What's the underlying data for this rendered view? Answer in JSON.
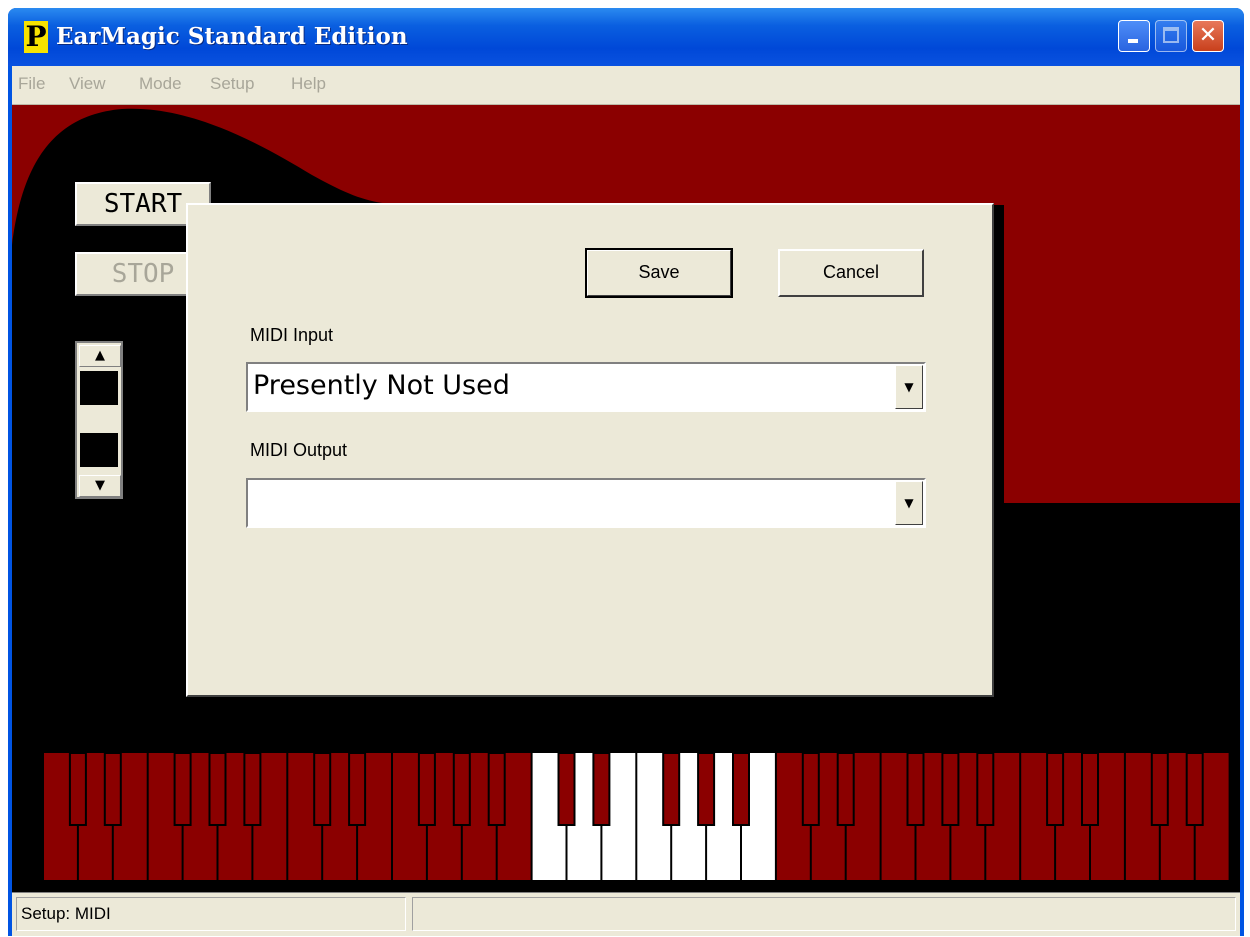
{
  "window": {
    "title": "EarMagic Standard Edition",
    "icon_letter": "P"
  },
  "titlebar_buttons": {
    "minimize": "minimize-icon",
    "maximize": "maximize-icon",
    "close": "close-icon"
  },
  "menu": {
    "items": [
      "File",
      "View",
      "Mode",
      "Setup",
      "Help"
    ]
  },
  "controls": {
    "start_label": "START",
    "stop_label": "STOP"
  },
  "spinner": {
    "up_icon": "triangle-up-icon",
    "down_icon": "triangle-down-icon"
  },
  "dialog": {
    "save_label": "Save",
    "cancel_label": "Cancel",
    "midi_input_label": "MIDI Input",
    "midi_input_value": "Presently Not Used",
    "midi_output_label": "MIDI Output",
    "midi_output_value": ""
  },
  "status": {
    "left": "Setup: MIDI",
    "right": ""
  },
  "colors": {
    "theme_red": "#8b0000",
    "background_black": "#000000",
    "key_white": "#ffffff",
    "dialog_bg": "#ece9d8"
  }
}
